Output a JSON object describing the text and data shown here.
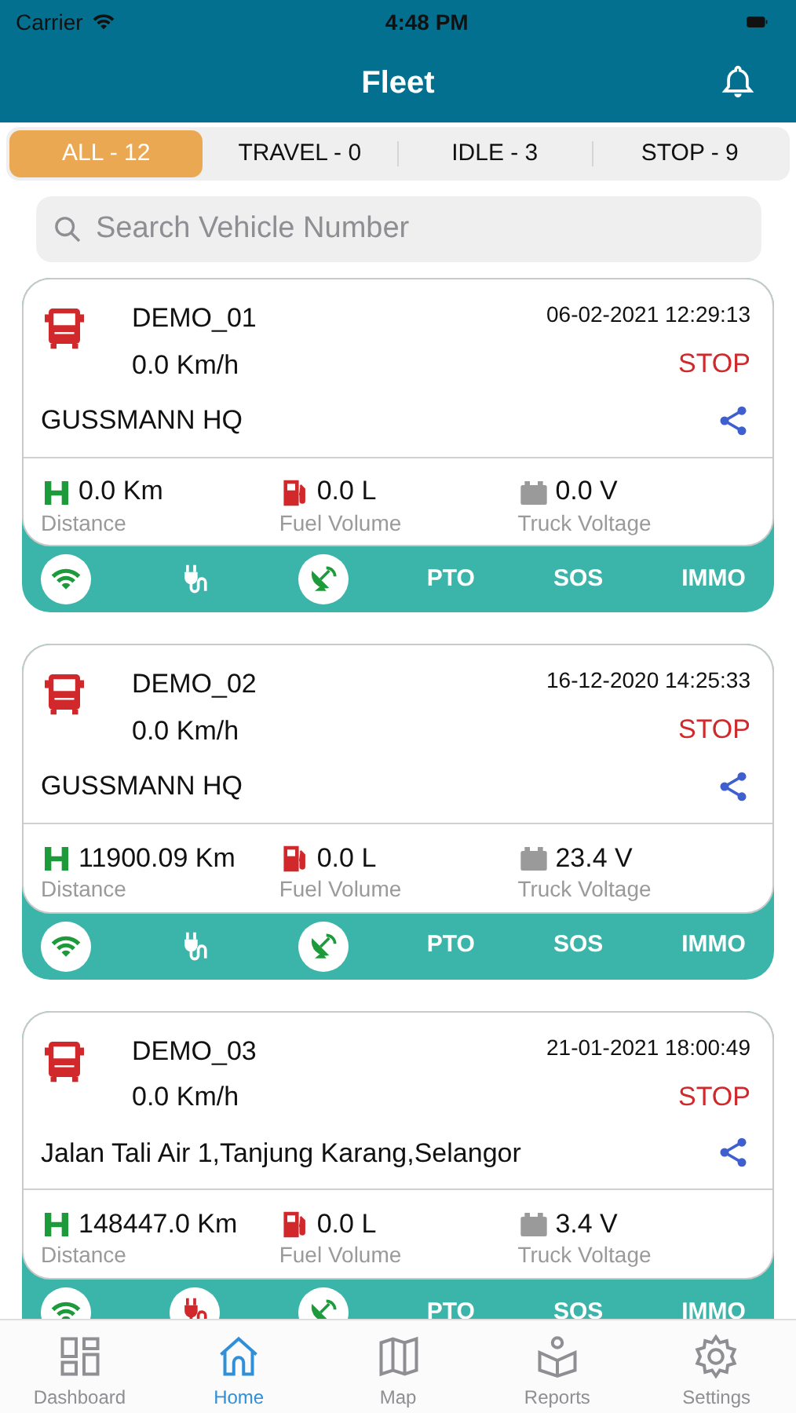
{
  "status_bar": {
    "carrier": "Carrier",
    "time": "4:48 PM"
  },
  "header": {
    "title": "Fleet"
  },
  "filter_tabs": [
    {
      "label": "ALL - 12",
      "selected": true
    },
    {
      "label": "TRAVEL - 0",
      "selected": false
    },
    {
      "label": "IDLE - 3",
      "selected": false
    },
    {
      "label": "STOP - 9",
      "selected": false
    }
  ],
  "search": {
    "placeholder": "Search Vehicle Number"
  },
  "vehicles": [
    {
      "name": "DEMO_01",
      "datetime": "06-02-2021 12:29:13",
      "speed": "0.0 Km/h",
      "status": "STOP",
      "color": "#d0282b",
      "address": "GUSSMANN HQ",
      "metrics": [
        {
          "kind": "distance",
          "value": "0.0 Km",
          "label": "Distance"
        },
        {
          "kind": "fuel",
          "value": "0.0 L",
          "label": "Fuel Volume"
        },
        {
          "kind": "voltage",
          "value": "0.0 V",
          "label": "Truck Voltage"
        }
      ],
      "indicators": [
        {
          "kind": "wifi",
          "on": true
        },
        {
          "kind": "power",
          "on": false
        },
        {
          "kind": "gps",
          "on": true
        }
      ],
      "flags": [
        "PTO",
        "SOS",
        "IMMO"
      ]
    },
    {
      "name": "DEMO_02",
      "datetime": "16-12-2020 14:25:33",
      "speed": "0.0 Km/h",
      "status": "STOP",
      "color": "#d0282b",
      "address": "GUSSMANN HQ",
      "metrics": [
        {
          "kind": "distance",
          "value": "11900.09 Km",
          "label": "Distance"
        },
        {
          "kind": "fuel",
          "value": "0.0 L",
          "label": "Fuel Volume"
        },
        {
          "kind": "voltage",
          "value": "23.4 V",
          "label": "Truck Voltage"
        }
      ],
      "indicators": [
        {
          "kind": "wifi",
          "on": true
        },
        {
          "kind": "power",
          "on": false
        },
        {
          "kind": "gps",
          "on": true
        }
      ],
      "flags": [
        "PTO",
        "SOS",
        "IMMO"
      ]
    },
    {
      "name": "DEMO_03",
      "datetime": "21-01-2021 18:00:49",
      "speed": "0.0 Km/h",
      "status": "STOP",
      "color": "#d0282b",
      "address": "Jalan Tali Air 1,Tanjung Karang,Selangor",
      "metrics": [
        {
          "kind": "distance",
          "value": "148447.0 Km",
          "label": "Distance"
        },
        {
          "kind": "fuel",
          "value": "0.0 L",
          "label": "Fuel Volume"
        },
        {
          "kind": "voltage",
          "value": "3.4 V",
          "label": "Truck Voltage"
        }
      ],
      "indicators": [
        {
          "kind": "wifi",
          "on": true
        },
        {
          "kind": "power",
          "on": true
        },
        {
          "kind": "gps",
          "on": true
        }
      ],
      "flags": [
        "PTO",
        "SOS",
        "IMMO"
      ]
    }
  ],
  "tab_bar": [
    {
      "kind": "dashboard",
      "label": "Dashboard",
      "selected": false
    },
    {
      "kind": "home",
      "label": "Home",
      "selected": true
    },
    {
      "kind": "map",
      "label": "Map",
      "selected": false
    },
    {
      "kind": "reports",
      "label": "Reports",
      "selected": false
    },
    {
      "kind": "settings",
      "label": "Settings",
      "selected": false
    }
  ]
}
